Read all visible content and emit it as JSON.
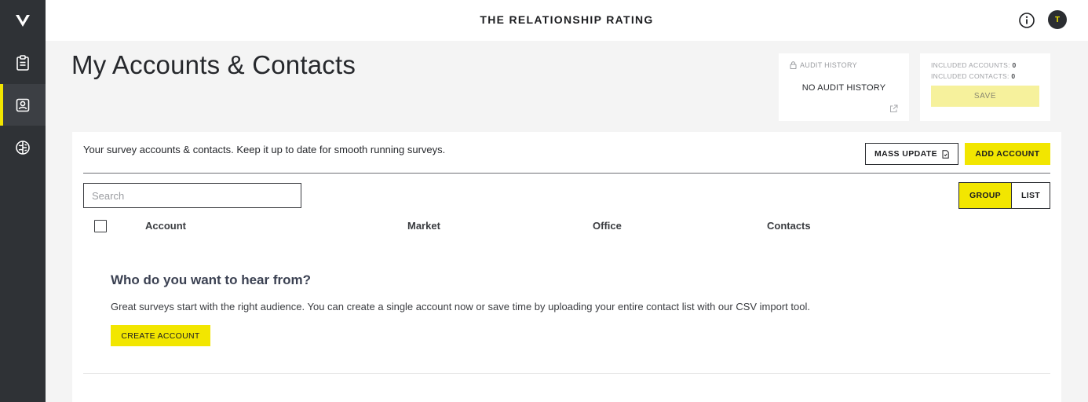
{
  "app": {
    "title": "THE RELATIONSHIP RATING",
    "user_initial": "T"
  },
  "sidebar": {
    "items": [
      {
        "icon": "clipboard-icon",
        "active": false
      },
      {
        "icon": "contact-card-icon",
        "active": true
      },
      {
        "icon": "brain-icon",
        "active": false
      }
    ]
  },
  "page": {
    "title": "My Accounts & Contacts"
  },
  "audit": {
    "label": "AUDIT HISTORY",
    "empty": "NO AUDIT HISTORY"
  },
  "included": {
    "accounts_label": "INCLUDED ACCOUNTS:",
    "accounts_value": "0",
    "contacts_label": "INCLUDED CONTACTS:",
    "contacts_value": "0",
    "save_label": "SAVE"
  },
  "main": {
    "intro": "Your survey accounts & contacts. Keep it up to date for smooth running surveys.",
    "mass_update_label": "MASS UPDATE",
    "add_account_label": "ADD ACCOUNT",
    "search_placeholder": "Search",
    "view_group": "GROUP",
    "view_list": "LIST",
    "columns": [
      "Account",
      "Market",
      "Office",
      "Contacts"
    ]
  },
  "empty_state": {
    "title": "Who do you want to hear from?",
    "text": "Great surveys start with the right audience. You can create a single account now or save time by uploading your entire contact list with our CSV import tool.",
    "button": "CREATE ACCOUNT"
  },
  "colors": {
    "accent": "#f2e600",
    "sidebar": "#2f3236",
    "text": "#26282c"
  }
}
